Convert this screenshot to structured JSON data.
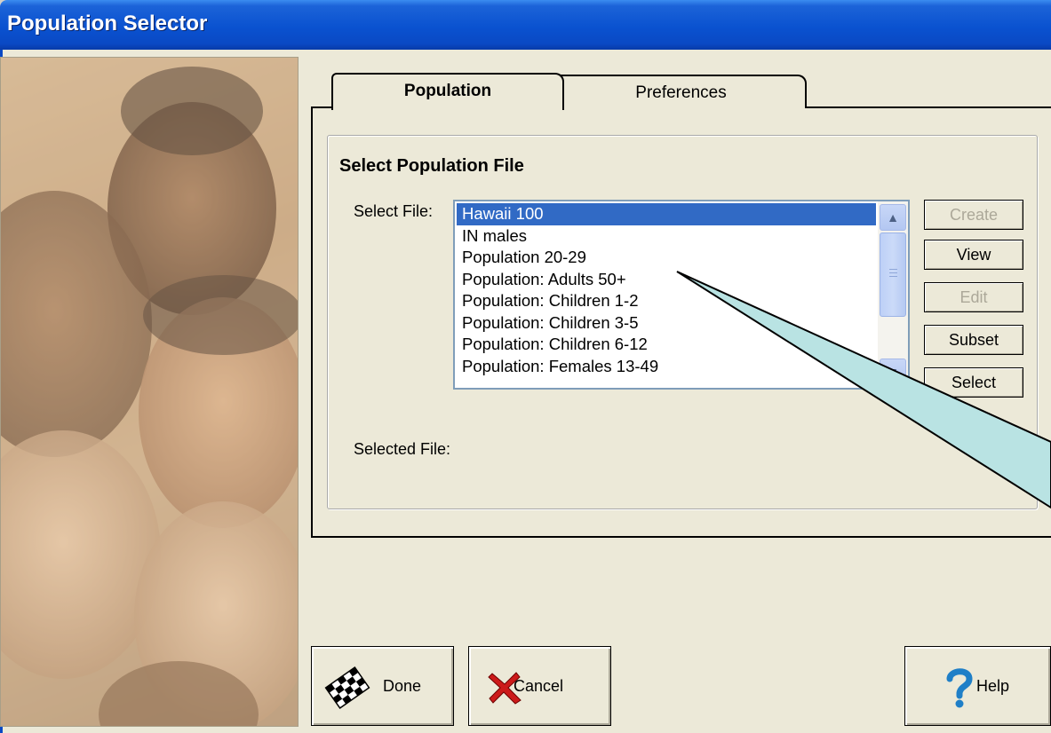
{
  "window": {
    "title": "Population Selector"
  },
  "tabs": [
    {
      "label": "Population",
      "active": true
    },
    {
      "label": "Preferences",
      "active": false
    }
  ],
  "group": {
    "title": "Select Population File",
    "select_file_label": "Select File:",
    "selected_file_label": "Selected File:",
    "selected_file_value": ""
  },
  "file_list": {
    "items": [
      "Hawaii 100",
      "IN males",
      "Population 20-29",
      "Population: Adults 50+",
      "Population: Children 1-2",
      "Population: Children 3-5",
      "Population: Children 6-12",
      "Population: Females 13-49"
    ],
    "selected": "Hawaii 100"
  },
  "side_buttons": {
    "create": "Create",
    "view": "View",
    "edit": "Edit",
    "subset": "Subset",
    "select": "Select"
  },
  "bottom_buttons": {
    "done": "Done",
    "cancel": "Cancel",
    "help": "Help"
  },
  "colors": {
    "titlebar": "#0a52d0",
    "selection": "#316ac5",
    "callout_fill": "#b9e3e3"
  },
  "icons": {
    "done": "checkered-flag-icon",
    "cancel": "red-x-icon",
    "help": "question-mark-icon"
  }
}
